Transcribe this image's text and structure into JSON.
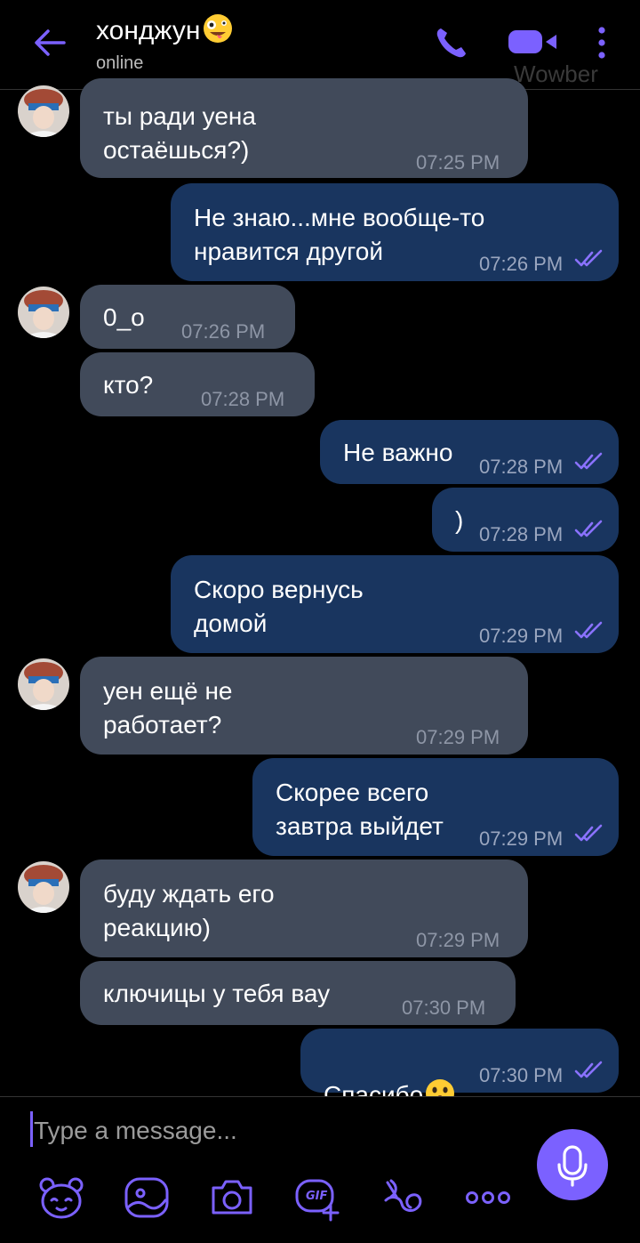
{
  "header": {
    "contact_name": "хонджун",
    "status": "online",
    "watermark": "Wowber"
  },
  "colors": {
    "accent": "#7b61ff",
    "incoming_bubble": "#414a5a",
    "outgoing_bubble": "#19355f",
    "background": "#000000"
  },
  "messages": [
    {
      "direction": "in",
      "text": "ты ради уена\nостаёшься?)",
      "time": "07:25 PM"
    },
    {
      "direction": "out",
      "text": "Не знаю...мне вообще-то\nнравится другой",
      "time": "07:26 PM",
      "read": true
    },
    {
      "direction": "in",
      "text": "0_o",
      "time": "07:26 PM"
    },
    {
      "direction": "in",
      "text": "кто?",
      "time": "07:28 PM"
    },
    {
      "direction": "out",
      "text": "Не важно",
      "time": "07:28 PM",
      "read": true
    },
    {
      "direction": "out",
      "text": ")",
      "time": "07:28 PM",
      "read": true
    },
    {
      "direction": "out",
      "text": "Скоро вернусь\nдомой",
      "time": "07:29 PM",
      "read": true
    },
    {
      "direction": "in",
      "text": "уен ещё не\nработает?",
      "time": "07:29 PM"
    },
    {
      "direction": "out",
      "text": "Скорее всего\nзавтра выйдет",
      "time": "07:29 PM",
      "read": true
    },
    {
      "direction": "in",
      "text": "буду ждать его\nреакцию)",
      "time": "07:29 PM"
    },
    {
      "direction": "in",
      "text": "ключицы у тебя вау",
      "time": "07:30 PM"
    },
    {
      "direction": "out",
      "text": "Спасибо",
      "time": "07:30 PM",
      "read": true,
      "emoji": "astonished-face-icon"
    }
  ],
  "composer": {
    "placeholder": "Type a message...",
    "toolbar": [
      "sticker-icon",
      "doodle-icon",
      "camera-icon",
      "gif-icon",
      "emoticon-icon",
      "more-options-icon"
    ],
    "gif_label": "GIF"
  }
}
